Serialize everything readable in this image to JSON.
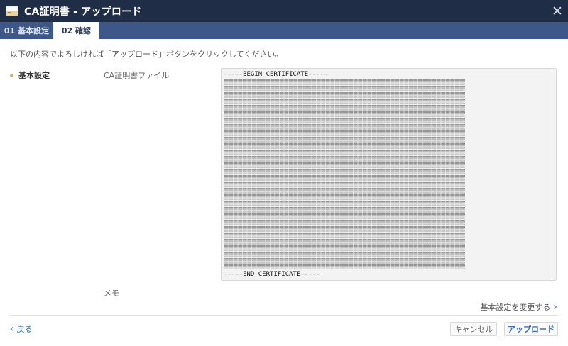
{
  "window": {
    "title": "CA証明書 - アップロード",
    "close_glyph": "✕"
  },
  "tabs": [
    {
      "label": "01 基本設定",
      "active": false
    },
    {
      "label": "02 確認",
      "active": true
    }
  ],
  "intro": "以下の内容でよろしければ「アップロード」ボタンをクリックしてください。",
  "section": {
    "title": "基本設定",
    "fields": {
      "ca_label": "CA証明書ファイル",
      "memo_label": "メモ"
    }
  },
  "certificate": {
    "begin": "-----BEGIN CERTIFICATE-----",
    "end": "-----END CERTIFICATE-----"
  },
  "actions": {
    "change_settings": "基本設定を変更する",
    "back": "戻る",
    "cancel": "キャンセル",
    "upload": "アップロード"
  },
  "colors": {
    "titlebar": "#1f2d46",
    "tabbar": "#3d5888",
    "accent": "#3b73c4"
  },
  "icons": {
    "title_icon": "certificate-icon",
    "close_icon": "close-icon",
    "back_icon": "chevron-left-icon",
    "change_icon": "chevron-right-icon"
  }
}
